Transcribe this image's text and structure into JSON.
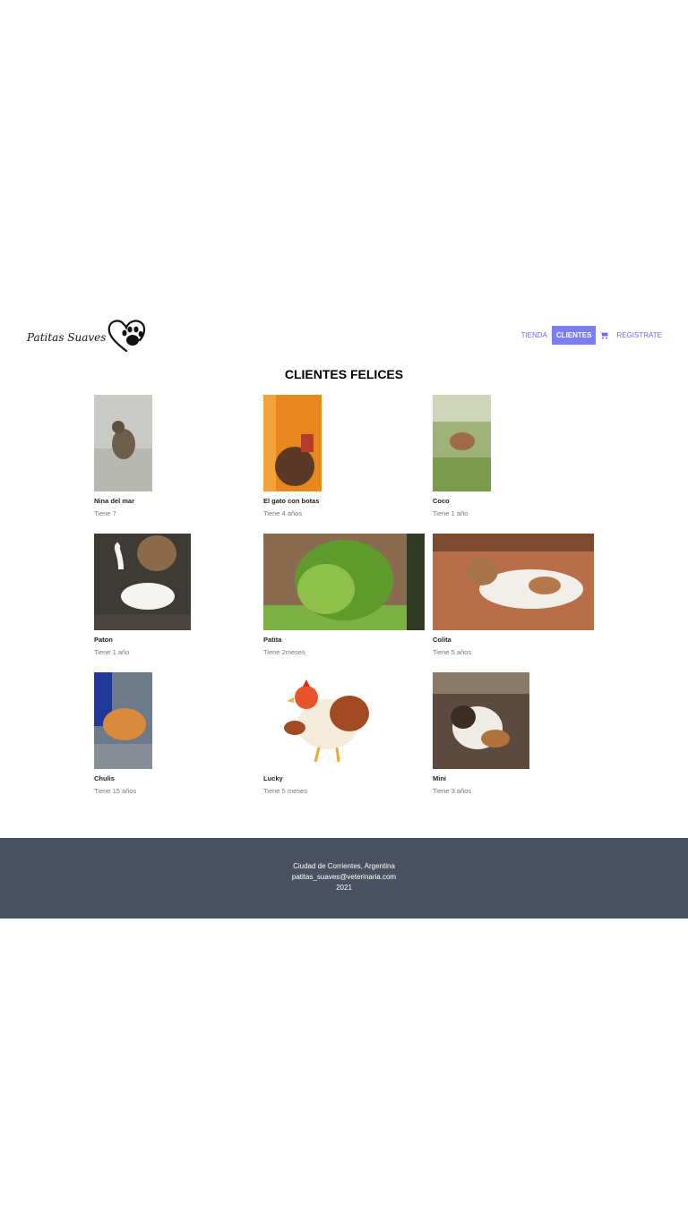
{
  "brand": {
    "name": "Patitas Suaves",
    "logo_icon": "heart-paw-icon"
  },
  "nav": {
    "items": [
      {
        "label": "TIENDA",
        "active": false
      },
      {
        "label": "CLIENTES",
        "active": true
      },
      {
        "label": "REGISTRATE",
        "active": false
      }
    ],
    "cart_icon": "cart-icon",
    "accent": "#7b7ef2"
  },
  "page_title": "CLIENTES FELICES",
  "clients": [
    {
      "name": "Nina del mar",
      "age": "Tiene 7"
    },
    {
      "name": "El gato con botas",
      "age": "Tiene 4 años"
    },
    {
      "name": "Coco",
      "age": "Tiene 1 año"
    },
    {
      "name": "Paton",
      "age": "Tiene 1 año"
    },
    {
      "name": "Patita",
      "age": "Tiene 2meses"
    },
    {
      "name": "Colita",
      "age": "Tiene 5 años"
    },
    {
      "name": "Chulis",
      "age": "Tiene 15 años"
    },
    {
      "name": "Lucky",
      "age": "Tiene 5 meses"
    },
    {
      "name": "Mini",
      "age": "Tiene 3 años"
    }
  ],
  "footer": {
    "location": "Ciudad de Corrientes, Argentina",
    "email": "patitas_suaves@veterinaria.com",
    "year": "2021",
    "background": "#4a5261"
  }
}
